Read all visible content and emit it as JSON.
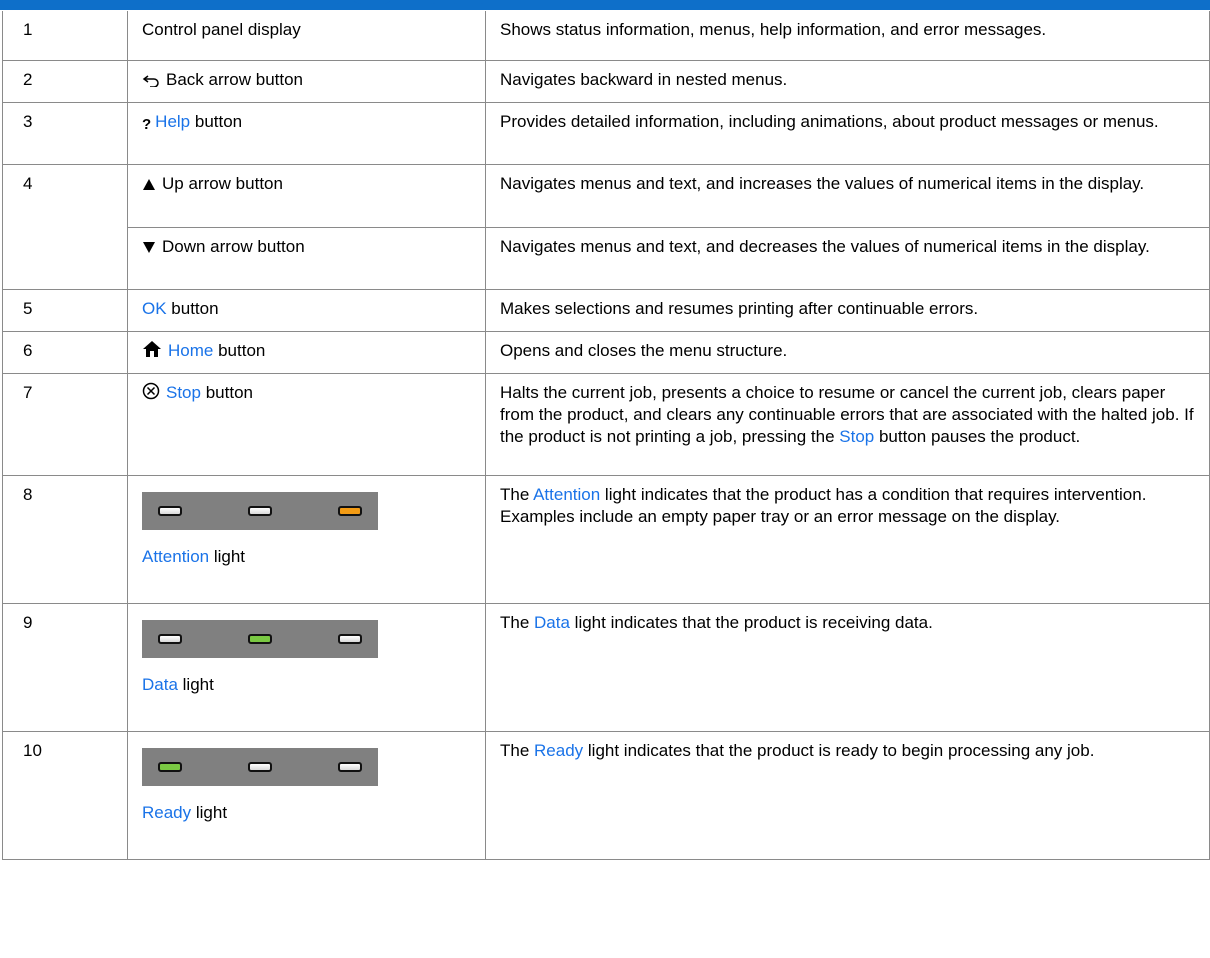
{
  "rows": [
    {
      "num": "1",
      "item": "Control panel display",
      "desc": "Shows status information, menus, help information, and error messages."
    },
    {
      "num": "2",
      "item": "Back arrow button",
      "icon": "back-arrow-icon",
      "desc": "Navigates backward in nested menus."
    },
    {
      "num": "3",
      "item_highlight": "Help",
      "item_rest": " button",
      "icon": "help-icon",
      "desc": "Provides detailed information, including animations, about product messages or menus."
    },
    {
      "num": "4",
      "item": "Up arrow button",
      "icon": "up-triangle-icon",
      "desc": "Navigates menus and text, and increases the values of numerical items in the display."
    },
    {
      "item": "Down arrow button",
      "icon": "down-triangle-icon",
      "desc": "Navigates menus and text, and decreases the values of numerical items in the display."
    },
    {
      "num": "5",
      "item_highlight": "OK",
      "item_rest": " button",
      "desc": "Makes selections and resumes printing after continuable errors."
    },
    {
      "num": "6",
      "item_highlight": "Home",
      "item_rest": " button",
      "icon": "home-icon",
      "desc": "Opens and closes the menu structure."
    },
    {
      "num": "7",
      "item_highlight": "Stop",
      "item_rest": " button",
      "icon": "stop-icon",
      "desc_part1": "Halts the current job, presents a choice to resume or cancel the current job, clears paper from the product, and clears any continuable errors that are associated with the halted job. If the product is not printing a job, pressing the ",
      "desc_highlight": "Stop",
      "desc_part2": " button pauses the product."
    },
    {
      "num": "8",
      "item_highlight": "Attention",
      "item_rest": " light",
      "leds": [
        "white",
        "white",
        "amber"
      ],
      "desc_part1": "The ",
      "desc_highlight": "Attention",
      "desc_part2": " light indicates that the product has a condition that requires intervention. Examples include an empty paper tray or an error message on the display."
    },
    {
      "num": "9",
      "item_highlight": "Data",
      "item_rest": " light",
      "leds": [
        "white",
        "green",
        "white"
      ],
      "desc_part1": "The ",
      "desc_highlight": "Data",
      "desc_part2": " light indicates that the product is receiving data."
    },
    {
      "num": "10",
      "item_highlight": "Ready",
      "item_rest": " light",
      "leds": [
        "green",
        "white",
        "white"
      ],
      "desc_part1": "The ",
      "desc_highlight": "Ready",
      "desc_part2": " light indicates that the product is ready to begin processing any job."
    }
  ],
  "colors": {
    "highlight": "#1a73e8",
    "header_bar": "#0e6fc9",
    "panel": "#808080",
    "amber": "#f39b14",
    "green": "#7ac943"
  }
}
